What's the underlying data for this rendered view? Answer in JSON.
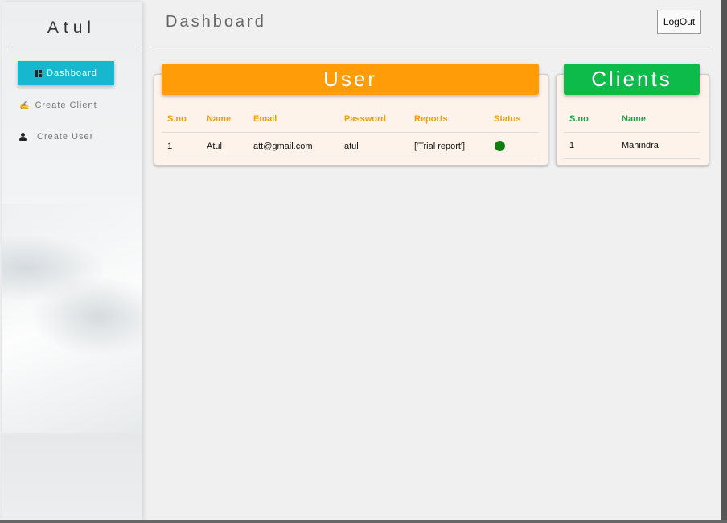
{
  "sidebar": {
    "brand": "Atul",
    "items": [
      {
        "label": "Dashboard",
        "icon": "dashboard-icon",
        "active": true
      },
      {
        "label": "Create Client",
        "icon": "handshake-icon",
        "active": false
      },
      {
        "label": "Create User",
        "icon": "user-icon",
        "active": false
      }
    ]
  },
  "header": {
    "title": "Dashboard",
    "logout_label": "LogOut"
  },
  "user_card": {
    "title": "User",
    "accent_color": "#ff9c08",
    "columns": [
      "S.no",
      "Name",
      "Email",
      "Password",
      "Reports",
      "Status"
    ],
    "rows": [
      {
        "sno": "1",
        "name": "Atul",
        "email": "att@gmail.com",
        "password": "atul",
        "reports": "['Trial report']",
        "status_color": "#0e7f0e"
      }
    ]
  },
  "clients_card": {
    "title": "Clients",
    "accent_color": "#0dbb4a",
    "columns": [
      "S.no",
      "Name"
    ],
    "rows": [
      {
        "sno": "1",
        "name": "Mahindra"
      }
    ]
  }
}
